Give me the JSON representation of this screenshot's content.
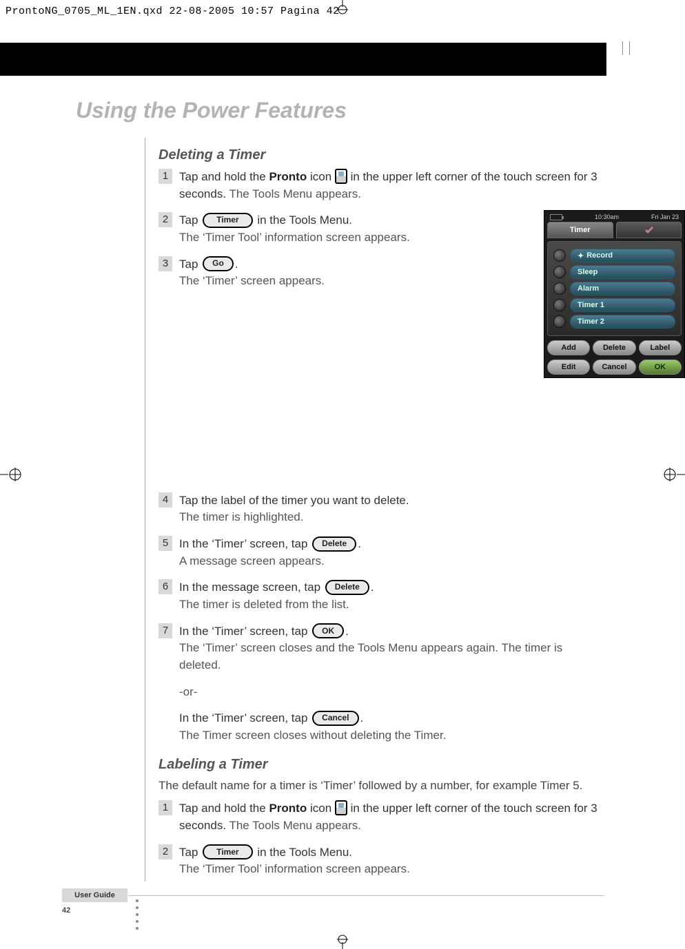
{
  "print": {
    "header": "ProntoNG_0705_ML_1EN.qxd   22-08-2005   10:57   Pagina 42"
  },
  "title": "Using the Power Features",
  "sections": {
    "deleting": {
      "heading": "Deleting a Timer",
      "step1": {
        "num": "1",
        "prefix": "Tap and hold the ",
        "bold1": "Pronto",
        "mid": " icon ",
        "suffix": " in the upper left corner of the touch screen for 3 seconds.",
        "sub": " The Tools Menu appears."
      },
      "step2": {
        "num": "2",
        "prefix": "Tap ",
        "btn": "Timer",
        "suffix": " in the Tools Menu.",
        "sub": "The ‘Timer Tool’ information screen appears."
      },
      "step3": {
        "num": "3",
        "prefix": "Tap ",
        "btn": "Go",
        "suffix": ".",
        "sub": "The ‘Timer’ screen appears."
      },
      "step4": {
        "num": "4",
        "main": "Tap the label of the timer you want to delete.",
        "sub": "The timer is highlighted."
      },
      "step5": {
        "num": "5",
        "prefix": "In the ‘Timer’ screen, tap ",
        "btn": "Delete",
        "suffix": ".",
        "sub": "A message screen appears."
      },
      "step6": {
        "num": "6",
        "prefix": "In the message screen, tap ",
        "btn": "Delete",
        "suffix": ".",
        "sub": "The timer is deleted from the list."
      },
      "step7": {
        "num": "7",
        "prefix": "In the ‘Timer’ screen, tap ",
        "btn": "OK",
        "suffix": ".",
        "sub": "The ‘Timer’ screen closes and the Tools Menu appears again. The timer is deleted."
      },
      "or": "-or-",
      "step7b": {
        "prefix": "In the ‘Timer’ screen, tap ",
        "btn": "Cancel",
        "suffix": ".",
        "sub": "The Timer screen closes without deleting the Timer."
      }
    },
    "labeling": {
      "heading": "Labeling a Timer",
      "intro": "The default name for a timer is ‘Timer’ followed by a number, for example Timer 5.",
      "step1": {
        "num": "1",
        "prefix": "Tap and hold the ",
        "bold1": "Pronto",
        "mid": " icon ",
        "suffix": " in the upper left corner of the touch screen for 3 seconds.",
        "sub": " The Tools Menu appears."
      },
      "step2": {
        "num": "2",
        "prefix": "Tap ",
        "btn": "Timer",
        "suffix": " in the Tools Menu.",
        "sub": "The ‘Timer Tool’ information screen appears."
      }
    }
  },
  "device": {
    "time": "10:30am",
    "date": "Fri Jan 23",
    "tab_timer": "Timer",
    "rows": {
      "record": "Record",
      "sleep": "Sleep",
      "alarm": "Alarm",
      "timer1": "Timer 1",
      "timer2": "Timer 2"
    },
    "buttons": {
      "add": "Add",
      "delete": "Delete",
      "label": "Label",
      "edit": "Edit",
      "cancel": "Cancel",
      "ok": "OK"
    }
  },
  "footer": {
    "label": "User Guide",
    "page": "42"
  }
}
